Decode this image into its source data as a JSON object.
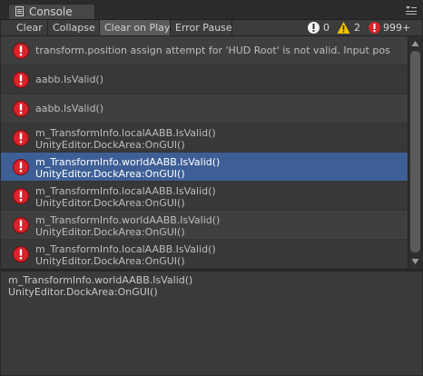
{
  "window": {
    "tab_label": "Console",
    "tab_icon": "console-icon",
    "menu_icon": "window-menu-icon"
  },
  "toolbar": {
    "clear_label": "Clear",
    "collapse_label": "Collapse",
    "clear_on_play_label": "Clear on Play",
    "error_pause_label": "Error Pause",
    "clear_on_play_active": true,
    "info_count": "0",
    "warning_count": "2",
    "error_count": "999+"
  },
  "log": {
    "entries": [
      {
        "line1": "transform.position assign attempt for 'HUD Root' is not valid. Input pos",
        "line2": "",
        "type": "error",
        "selected": false
      },
      {
        "line1": "aabb.IsValid()",
        "line2": "",
        "type": "error",
        "selected": false
      },
      {
        "line1": "aabb.IsValid()",
        "line2": "",
        "type": "error",
        "selected": false
      },
      {
        "line1": "m_TransformInfo.localAABB.IsValid()",
        "line2": "UnityEditor.DockArea:OnGUI()",
        "type": "error",
        "selected": false
      },
      {
        "line1": "m_TransformInfo.worldAABB.IsValid()",
        "line2": "UnityEditor.DockArea:OnGUI()",
        "type": "error",
        "selected": true
      },
      {
        "line1": "m_TransformInfo.localAABB.IsValid()",
        "line2": "UnityEditor.DockArea:OnGUI()",
        "type": "error",
        "selected": false
      },
      {
        "line1": "m_TransformInfo.worldAABB.IsValid()",
        "line2": "UnityEditor.DockArea:OnGUI()",
        "type": "error",
        "selected": false
      },
      {
        "line1": "m_TransformInfo.localAABB.IsValid()",
        "line2": "UnityEditor.DockArea:OnGUI()",
        "type": "error",
        "selected": false
      }
    ]
  },
  "detail": {
    "line1": "m_TransformInfo.worldAABB.IsValid()",
    "line2": "UnityEditor.DockArea:OnGUI()"
  },
  "colors": {
    "error_red": "#d8232a",
    "warning_yellow": "#f0c400",
    "selection_blue": "#3e5f96"
  }
}
